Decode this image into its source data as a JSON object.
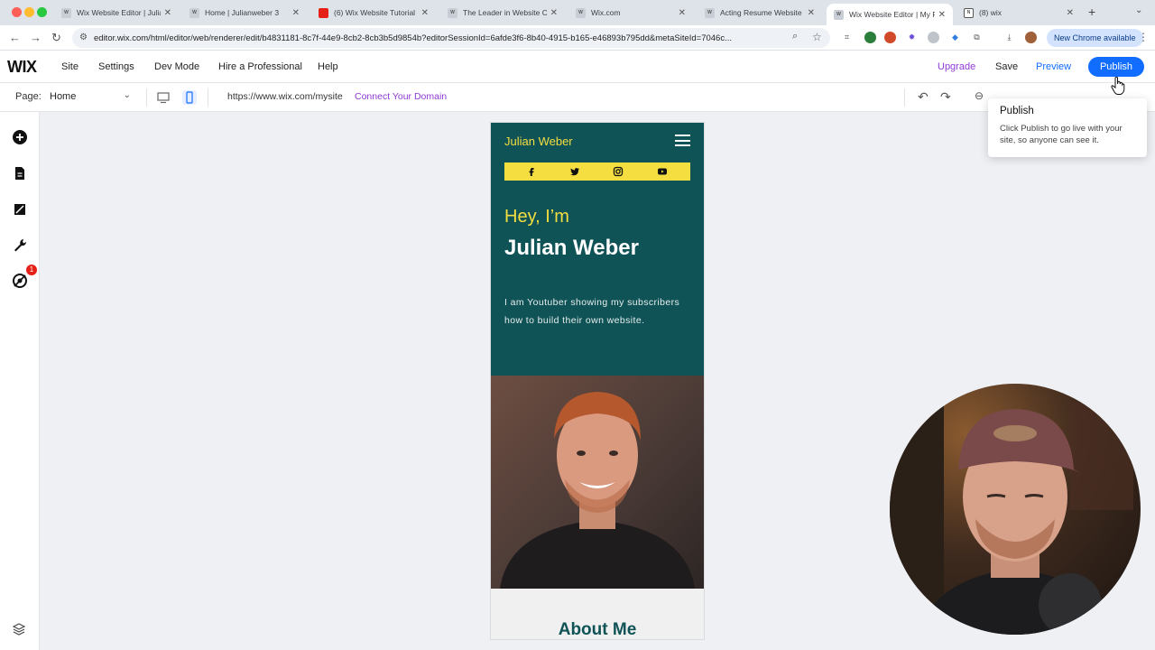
{
  "browser": {
    "tabs": [
      {
        "title": "Wix Website Editor | Julia",
        "favicon": "wix-favicon",
        "active": false
      },
      {
        "title": "Home | Julianweber 3",
        "favicon": "wix-favicon",
        "active": false
      },
      {
        "title": "(6) Wix Website Tutorial",
        "favicon": "youtube-favicon",
        "active": false
      },
      {
        "title": "The Leader in Website C",
        "favicon": "wix-favicon",
        "active": false
      },
      {
        "title": "Wix.com",
        "favicon": "wix-favicon",
        "active": false
      },
      {
        "title": "Acting Resume Website T",
        "favicon": "wix-favicon",
        "active": false
      },
      {
        "title": "Wix Website Editor | My F",
        "favicon": "wix-favicon",
        "active": true
      },
      {
        "title": "(8) wix",
        "favicon": "notion-favicon",
        "active": false
      }
    ],
    "url": "editor.wix.com/html/editor/web/renderer/edit/b4831181-8c7f-44e9-8cb2-8cb3b5d9854b?editorSessionId=6afde3f6-8b40-4915-b165-e46893b795dd&metaSiteId=7046c...",
    "new_chrome_label": "New Chrome available"
  },
  "wix": {
    "logo": "WIX",
    "menu": [
      "Site",
      "Settings",
      "Dev Mode",
      "Hire a Professional",
      "Help"
    ],
    "upgrade_label": "Upgrade",
    "save_label": "Save",
    "preview_label": "Preview",
    "publish_label": "Publish",
    "page_label": "Page:",
    "page_value": "Home",
    "site_url": "https://www.wix.com/mysite",
    "connect_domain_label": "Connect Your Domain",
    "notification_count": "1"
  },
  "tooltip": {
    "title": "Publish",
    "body": "Click Publish to go live with your site, so anyone can see it."
  },
  "site_preview": {
    "site_name": "Julian Weber",
    "greeting": "Hey, I’m",
    "name": "Julian Weber",
    "bio": "I am Youtuber showing my subscribers how to build their own website.",
    "section_heading": "About Me",
    "social_icons": [
      "facebook-icon",
      "twitter-icon",
      "instagram-icon",
      "youtube-icon"
    ]
  },
  "colors": {
    "wix_blue": "#116dff",
    "upgrade_purple": "#8e3ad6",
    "site_teal": "#0f5356",
    "site_yellow": "#f5de3f"
  }
}
